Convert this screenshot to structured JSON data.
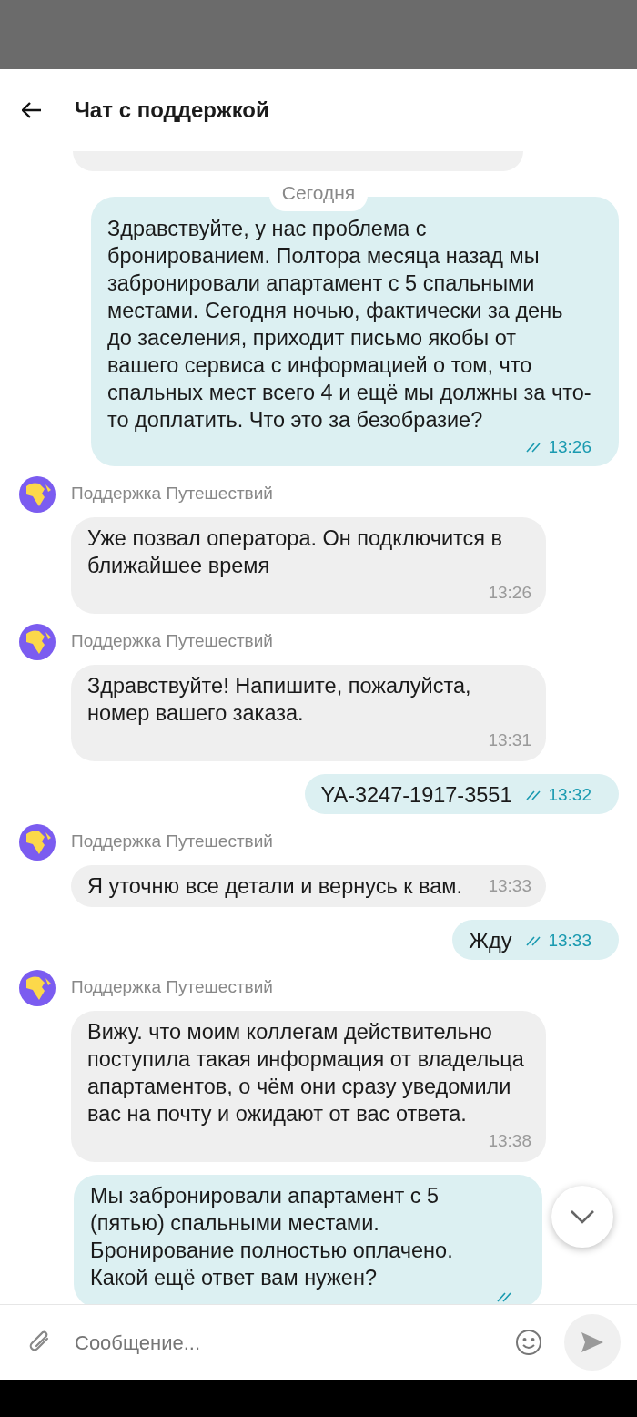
{
  "header": {
    "title": "Чат с поддержкой"
  },
  "date_divider": "Сегодня",
  "messages": [
    {
      "kind": "outgoing",
      "text": "Здравствуйте, у нас проблема с бронированием. Полтора месяца назад мы забронировали апартамент с 5 спальными местами. Сегодня ночью, фактически за день до заселения, приходит письмо якобы от вашего сервиса с информацией о том, что спальных мест всего 4 и ещё мы должны за что-то доплатить. Что это за безобразие?",
      "time": "13:26",
      "read": true
    },
    {
      "kind": "incoming",
      "sender": "Поддержка Путешествий",
      "text": "Уже позвал оператора. Он подключится в ближайшее время",
      "time": "13:26"
    },
    {
      "kind": "incoming",
      "sender": "Поддержка Путешествий",
      "text": "Здравствуйте! Напишите, пожалуйста, номер вашего заказа.",
      "time": "13:31"
    },
    {
      "kind": "outgoing",
      "text": "YA-3247-1917-3551",
      "time": "13:32",
      "read": true
    },
    {
      "kind": "incoming",
      "sender": "Поддержка Путешествий",
      "text": "Я уточню все детали и вернусь к вам.",
      "time": "13:33"
    },
    {
      "kind": "outgoing",
      "text": "Жду",
      "time": "13:33",
      "read": true
    },
    {
      "kind": "incoming",
      "sender": "Поддержка Путешествий",
      "text": "Вижу. что моим коллегам действительно поступила такая информация от владельца апартаментов, о чём они сразу уведомили вас на почту и ожидают от вас ответа.",
      "time": "13:38"
    },
    {
      "kind": "outgoing",
      "text": "Мы забронировали апартамент с 5 (пятью) спальными местами. Бронирование полностью оплачено. Какой ещё ответ вам нужен?",
      "read": true
    }
  ],
  "composer": {
    "placeholder": "Сообщение..."
  }
}
